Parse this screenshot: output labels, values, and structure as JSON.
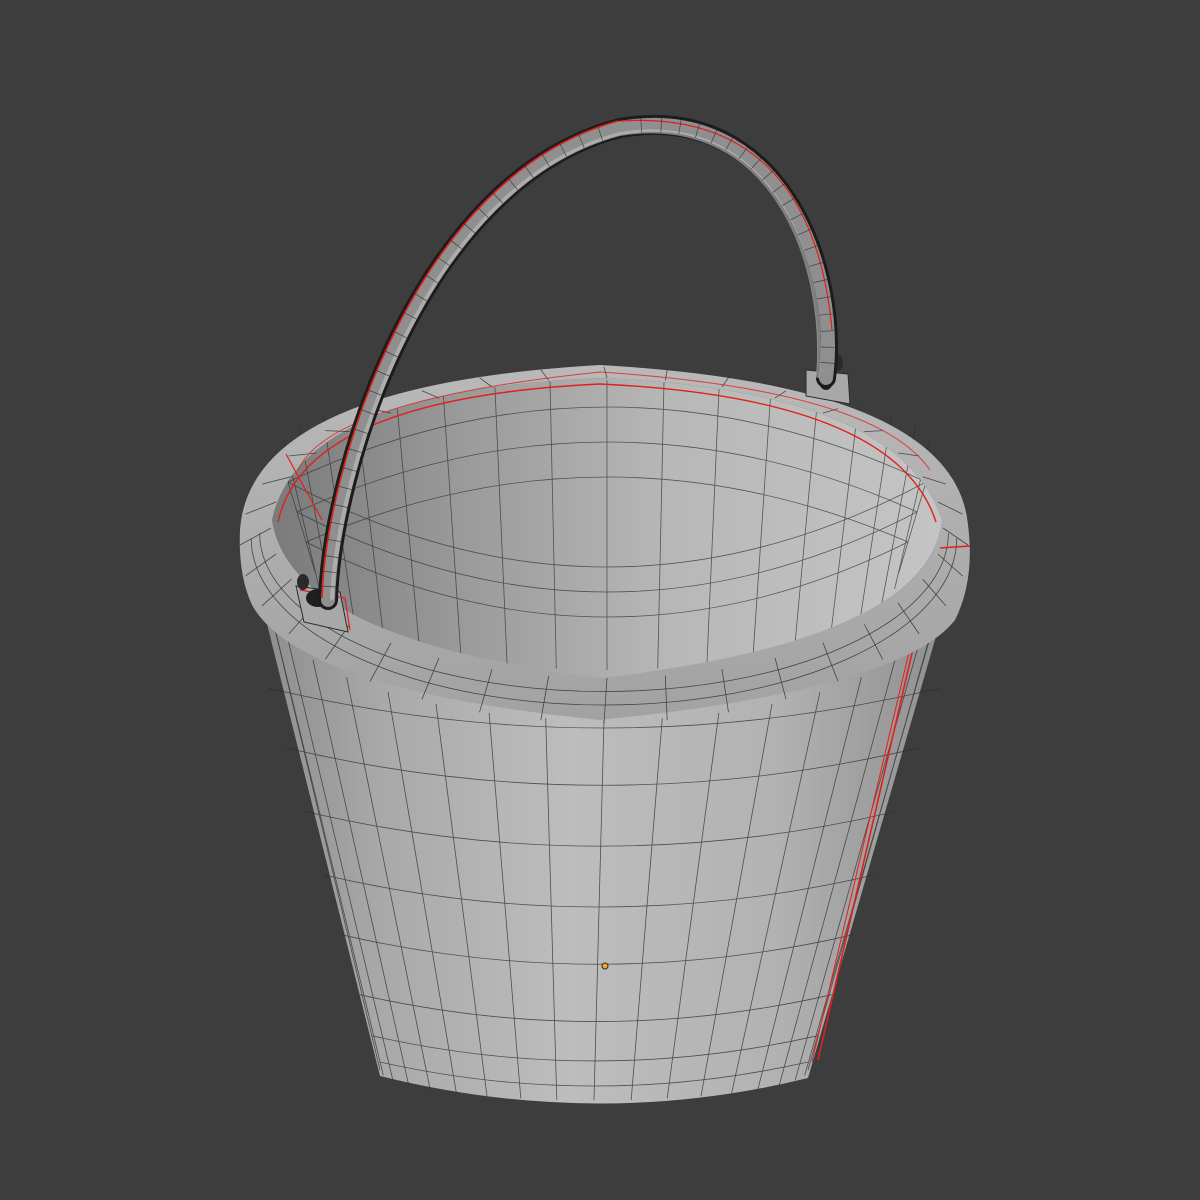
{
  "viewport": {
    "background_color": "#3d3d3d",
    "view_mode": "solid-wireframe",
    "mesh_object": "bucket"
  },
  "mesh": {
    "surface_color": "#b4b4b4",
    "surface_dark_color": "#8a8a8a",
    "wire_color": "#2a2a2a",
    "seam_color": "#e0201c",
    "origin_color": "#f2a81d",
    "segments": 36,
    "parts": [
      "bucket-body",
      "bucket-rim",
      "bucket-interior",
      "handle",
      "handle-lug-left",
      "handle-lug-right"
    ]
  }
}
